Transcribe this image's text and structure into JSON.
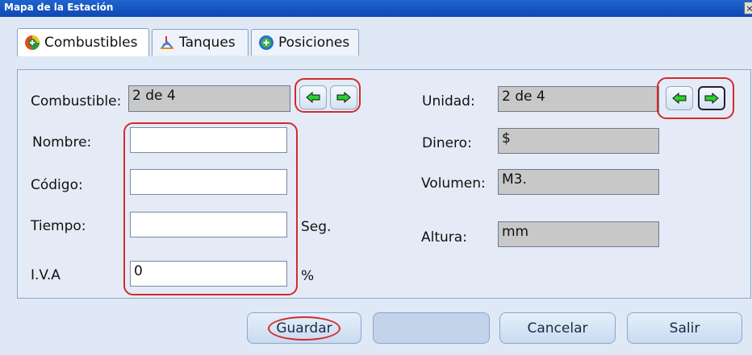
{
  "window": {
    "title": "Mapa de la Estación",
    "close_label": "×"
  },
  "tabs": [
    {
      "label": "Combustibles",
      "icon": "fuel-plus-icon",
      "active": true
    },
    {
      "label": "Tanques",
      "icon": "tanks-icon",
      "active": false
    },
    {
      "label": "Posiciones",
      "icon": "positions-plus-icon",
      "active": false
    }
  ],
  "left": {
    "combustible_label": "Combustible:",
    "combustible_value": "2 de 4",
    "nombre_label": "Nombre:",
    "nombre_value": "",
    "codigo_label": "Código:",
    "codigo_value": "",
    "tiempo_label": "Tiempo:",
    "tiempo_value": "",
    "tiempo_unit": "Seg.",
    "iva_label": "I.V.A",
    "iva_value": "0",
    "iva_unit": "%"
  },
  "right": {
    "unidad_label": "Unidad:",
    "unidad_value": "2 de 4",
    "dinero_label": "Dinero:",
    "dinero_value": "$",
    "volumen_label": "Volumen:",
    "volumen_value": "M3.",
    "altura_label": "Altura:",
    "altura_value": "mm"
  },
  "buttons": {
    "guardar": "Guardar",
    "blank": "",
    "cancelar": "Cancelar",
    "salir": "Salir"
  },
  "colors": {
    "highlight_red": "#d42a2a",
    "arrow_green": "#2fcf2f",
    "title_blue": "#1a56c4"
  }
}
